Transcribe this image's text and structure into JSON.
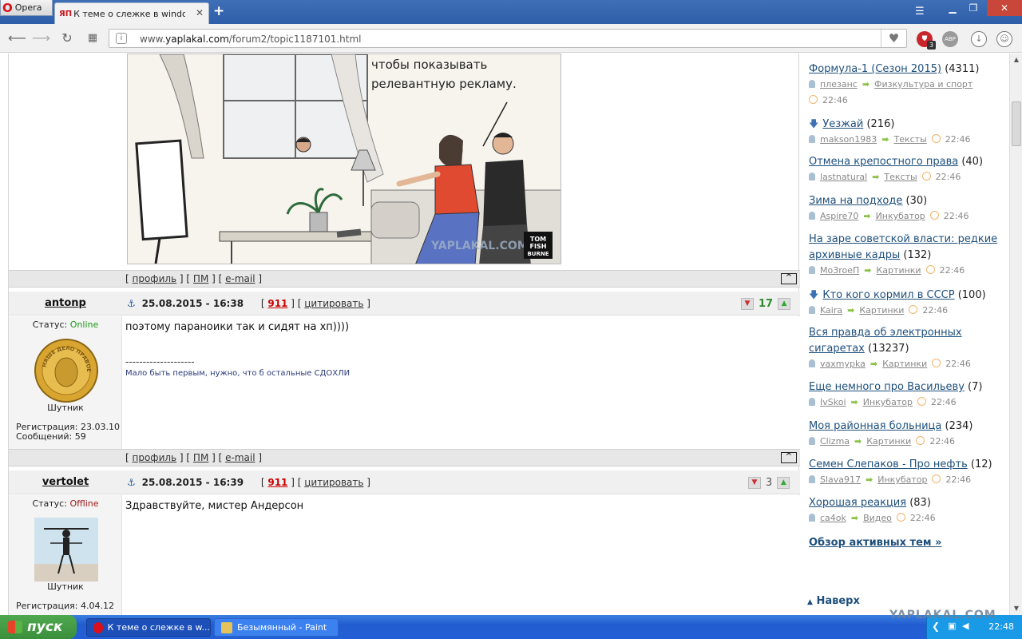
{
  "browser": {
    "menu_label": "Opera",
    "tab_title": "К теме о слежке в windows",
    "tab_favicon": "ЯП",
    "url_prefix": "www.",
    "url_domain": "yaplakal.com",
    "url_path": "/forum2/topic1187101.html",
    "ext_badge": "3",
    "adblock_label": "ABP"
  },
  "comic": {
    "caption_line1": "чтобы показывать",
    "caption_line2": "релевантную рекламу.",
    "watermark": "YAPLAKAL.COM",
    "artist_line1": "TOM",
    "artist_line2": "FISH",
    "artist_line3": "BURNE"
  },
  "postbar": {
    "profile": "профиль",
    "pm": "ПМ",
    "email": "e-mail",
    "to_top": "[^]"
  },
  "posts": [
    {
      "author": "antonp",
      "date": "25.08.2015 - 16:38",
      "number": "911",
      "quote": "цитировать",
      "rating": "17",
      "status_label": "Статус:",
      "status": "Online",
      "rank": "Шутник",
      "registration": "Регистрация: 23.03.10",
      "messages": "Сообщений: 59",
      "text": "поэтому параноики так и сидят на хп))))",
      "sig_line": "--------------------",
      "signature": "Мало быть первым, нужно, что б остальные СДОХЛИ",
      "avatar_text": "НАШЕ ДЕЛО ПРАВОЕ МЫ ПОБЕДИЛИ"
    },
    {
      "author": "vertolet",
      "date": "25.08.2015 - 16:39",
      "number": "911",
      "quote": "цитировать",
      "rating": "3",
      "status_label": "Статус:",
      "status": "Offline",
      "rank": "Шутник",
      "registration": "Регистрация: 4.04.12",
      "text": "Здравствуйте, мистер Андерсон"
    }
  ],
  "sidebar": {
    "topics": [
      {
        "title": "Формула-1 (Сезон 2015)",
        "count": "(4311)",
        "user": "плезанс",
        "section": "Физкультура и спорт",
        "time": "22:46"
      },
      {
        "title": "Уезжай",
        "count": "(216)",
        "user": "makson1983",
        "section": "Тексты",
        "time": "22:46",
        "pinned": true
      },
      {
        "title": "Отмена крепостного права",
        "count": "(40)",
        "user": "lastnatural",
        "section": "Тексты",
        "time": "22:46"
      },
      {
        "title": "Зима на подходе",
        "count": "(30)",
        "user": "Aspire70",
        "section": "Инкубатор",
        "time": "22:46"
      },
      {
        "title": "На заре советской власти: редкие архивные кадры",
        "count": "(132)",
        "user": "Mo3roeП",
        "section": "Картинки",
        "time": "22:46"
      },
      {
        "title": "Кто кого кормил в СССР",
        "count": "(100)",
        "user": "Kaira",
        "section": "Картинки",
        "time": "22:46",
        "pinned": true
      },
      {
        "title": "Вся правда об электронных сигаретах",
        "count": "(13237)",
        "user": "vaxmypka",
        "section": "Картинки",
        "time": "22:46"
      },
      {
        "title": "Еще немного про Васильеву",
        "count": "(7)",
        "user": "IvSkoi",
        "section": "Инкубатор",
        "time": "22:46"
      },
      {
        "title": "Моя районная больница",
        "count": "(234)",
        "user": "Clizma",
        "section": "Картинки",
        "time": "22:46"
      },
      {
        "title": "Семен Слепаков - Про нефть",
        "count": "(12)",
        "user": "Slava917",
        "section": "Инкубатор",
        "time": "22:46"
      },
      {
        "title": "Хорошая реакция",
        "count": "(83)",
        "user": "ca4ok",
        "section": "Видео",
        "time": "22:46"
      }
    ],
    "overview": "Обзор активных тем »",
    "back_to_top": "Наверх"
  },
  "taskbar": {
    "start": "пуск",
    "task1": "К теме о слежке в w...",
    "task2": "Безымянный - Paint",
    "clock": "22:48",
    "watermark": "YAPLAKAL.COM"
  },
  "colors": {
    "online": "#1a9a1a",
    "offline": "#a01818",
    "link": "#1e4f7c",
    "post_number": "#cc0000"
  }
}
